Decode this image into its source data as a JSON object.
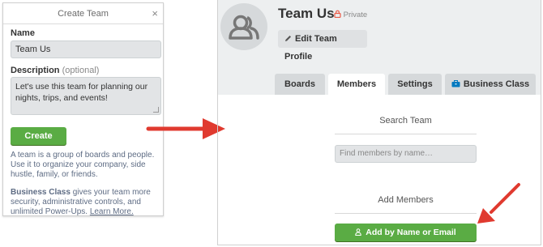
{
  "create_team": {
    "title": "Create Team",
    "close_glyph": "×",
    "name_label": "Name",
    "name_value": "Team Us",
    "description_label": "Description",
    "description_optional": "(optional)",
    "description_value": "Let's use this team for planning our nights, trips, and events!",
    "create_button": "Create",
    "help_text": "A team is a group of boards and people. Use it to organize your company, side hustle, family, or friends.",
    "business_class_bold": "Business Class",
    "business_class_text": " gives your team more security, administrative controls, and unlimited Power-Ups. ",
    "learn_more": "Learn More."
  },
  "team": {
    "name": "Team Us",
    "visibility": "Private",
    "edit_button": "Edit Team Profile",
    "tabs": [
      {
        "label": "Boards"
      },
      {
        "label": "Members"
      },
      {
        "label": "Settings"
      },
      {
        "label": "Business Class"
      }
    ],
    "active_tab": "Members",
    "search_title": "Search Team",
    "search_placeholder": "Find members by name…",
    "add_title": "Add Members",
    "add_button": "Add by Name or Email"
  },
  "colors": {
    "primary_green": "#5aac44",
    "annotation_red": "#e03a2f",
    "lock_red": "#eb5a46"
  },
  "icons": {
    "close": "close-icon",
    "avatar": "team-avatar-icon",
    "lock": "lock-icon",
    "pencil": "pencil-icon",
    "briefcase": "briefcase-icon",
    "person": "person-icon"
  }
}
